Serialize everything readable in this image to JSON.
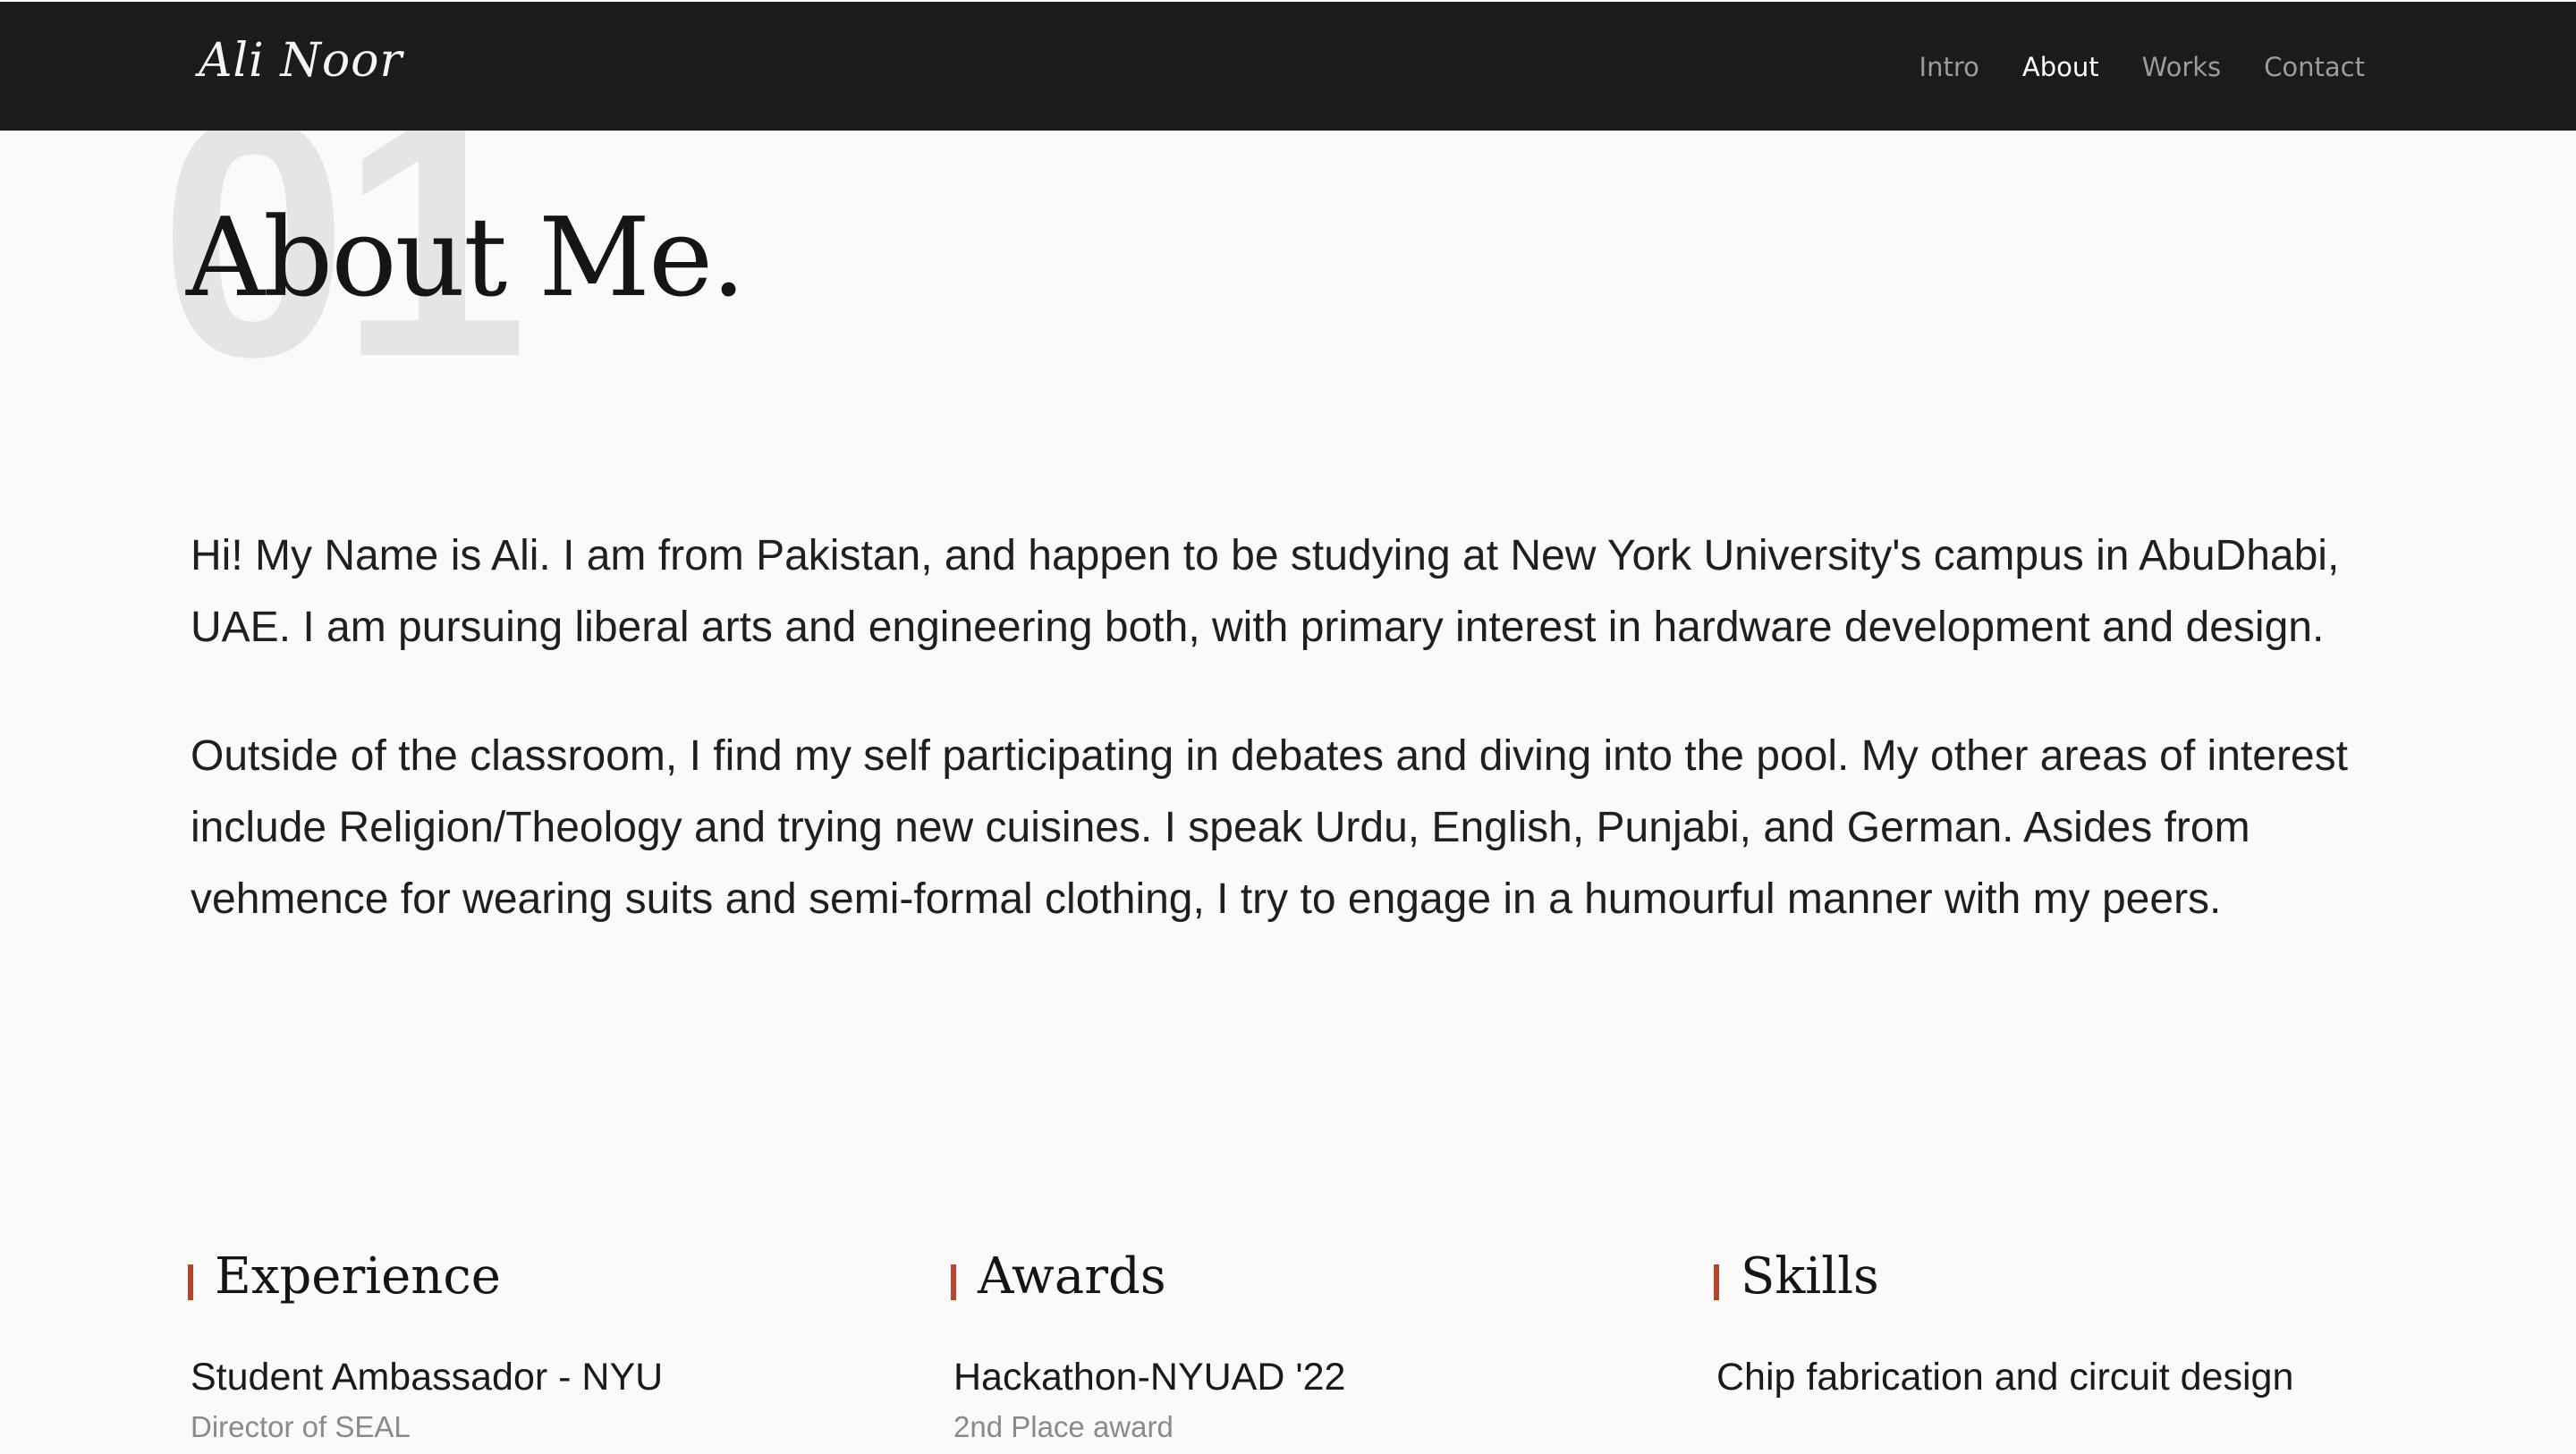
{
  "header": {
    "logo": "Ali Noor",
    "nav": [
      {
        "label": "Intro"
      },
      {
        "label": "About"
      },
      {
        "label": "Works"
      },
      {
        "label": "Contact"
      }
    ],
    "active_nav": "About"
  },
  "about": {
    "number": "01",
    "title": "About Me.",
    "paragraphs": [
      "Hi! My Name is Ali. I am from Pakistan, and happen to be studying at New York University's campus in AbuDhabi, UAE. I am pursuing liberal arts and engineering both, with primary interest in hardware development and design.",
      "Outside of the classroom, I find my self participating in debates and diving into the pool. My other areas of interest include Religion/Theology and trying new cuisines. I speak Urdu, English, Punjabi, and German. Asides from vehmence for wearing suits and semi-formal clothing, I try to engage in a humourful manner with my peers."
    ]
  },
  "experience": {
    "heading": "Experience",
    "items": [
      {
        "title": "Student Ambassador - NYU",
        "subtitle": "Director of SEAL"
      }
    ]
  },
  "awards": {
    "heading": "Awards",
    "items": [
      {
        "title": "Hackathon-NYUAD '22",
        "subtitle": "2nd Place award"
      }
    ]
  },
  "skills": {
    "heading": "Skills",
    "items": [
      {
        "title": "Chip fabrication and circuit design"
      }
    ]
  },
  "colors": {
    "header_bg": "#1b1b1b",
    "page_bg": "#fafafa",
    "accent": "#b5442c",
    "nav_inactive": "#9b9b9b",
    "nav_active": "#ffffff",
    "section_number": "#e4e6e4"
  }
}
